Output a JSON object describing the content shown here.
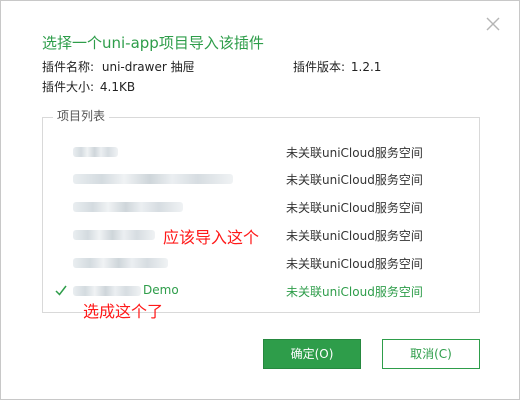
{
  "dialog": {
    "title": "选择一个uni-app项目导入该插件",
    "close_icon": "close-icon"
  },
  "plugin": {
    "name_label": "插件名称:",
    "name_value": "uni-drawer 抽屉",
    "version_label": "插件版本:",
    "version_value": "1.2.1",
    "size_label": "插件大小:",
    "size_value": "4.1KB"
  },
  "project_list": {
    "legend": "项目列表",
    "rows": [
      {
        "name_visible": "",
        "status": "未关联uniCloud服务空间",
        "selected": false
      },
      {
        "name_visible": "",
        "status": "未关联uniCloud服务空间",
        "selected": false
      },
      {
        "name_visible": "",
        "status": "未关联uniCloud服务空间",
        "selected": false
      },
      {
        "name_visible": "",
        "status": "未关联uniCloud服务空间",
        "selected": false
      },
      {
        "name_visible": "",
        "status": "未关联uniCloud服务空间",
        "selected": false
      },
      {
        "name_visible": "Demo",
        "status": "未关联uniCloud服务空间",
        "selected": true,
        "check_icon": "checkmark-icon"
      }
    ]
  },
  "annotations": {
    "should_import": "应该导入这个",
    "selected_this": "选成这个了"
  },
  "buttons": {
    "ok_label": "确定(O)",
    "cancel_label": "取消(C)"
  },
  "colors": {
    "accent": "#2e9d4a",
    "annotation": "#ff1a1a"
  }
}
